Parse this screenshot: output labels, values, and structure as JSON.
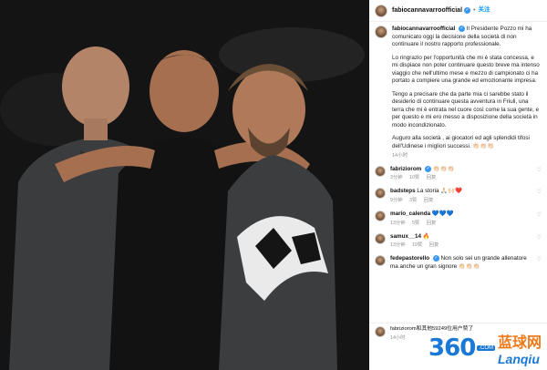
{
  "post": {
    "username": "fabiocannavarroofficial",
    "verified_mark": "✓",
    "follow_label": "关注",
    "caption_user": "fabiocannavarroofficial",
    "caption_paragraphs": [
      "Il Presidente Pozzo mi ha comunicato oggi la decisione della società di non continuare il nostro rapporto professionale.",
      "Lo ringrazio per l'opportunità che mi è stata concessa, e mi dispiace non poter continuare questo breve ma intenso viaggio che nell'ultimo mese e mezzo di campionato ci ha portato a compiere una grande ed emozionante impresa.",
      "Tengo a precisare che da parte mia ci sarebbe stato il desiderio di continuare questa avventura in Friuli, una terra che mi è entrata nel cuore così come la sua gente, e per questo e mi ero messo a disposizione della società in modo incondizionato.",
      "Auguro alla società , ai giocatori ed agli splendidi tifosi dell'Udinese i migliori successi. 👏🏻👏🏻👏🏻"
    ],
    "caption_time": "14小时"
  },
  "comments": [
    {
      "user": "fabriziorom",
      "verified": true,
      "text": "👏🏻👏🏻👏🏻",
      "time": "3分钟",
      "likes": "10赞",
      "reply": "回复"
    },
    {
      "user": "badsteps",
      "verified": false,
      "text": "La storia 🙏🏻🙌🏻❤️",
      "time": "9分钟",
      "likes": "3赞",
      "reply": "回复"
    },
    {
      "user": "mario_calenda",
      "verified": false,
      "text": "💙💙💙",
      "time": "13分钟",
      "likes": "5赞",
      "reply": "回复"
    },
    {
      "user": "samux__14",
      "verified": false,
      "text": "🔥",
      "time": "13分钟",
      "likes": "19赞",
      "reply": "回复"
    },
    {
      "user": "fedepastorello",
      "verified": true,
      "text": "Non solo sei un grande allenatore ma anche un gran signore 👏🏻👏🏻👏🏻",
      "time": "",
      "likes": "",
      "reply": ""
    }
  ],
  "bottom": {
    "text": "fabriziorom和其他59249位用户赞了",
    "time": "14小时"
  },
  "watermark": {
    "logo": "360",
    "com": ".COM",
    "cn": "蓝球网",
    "en": "Lanqiu"
  }
}
